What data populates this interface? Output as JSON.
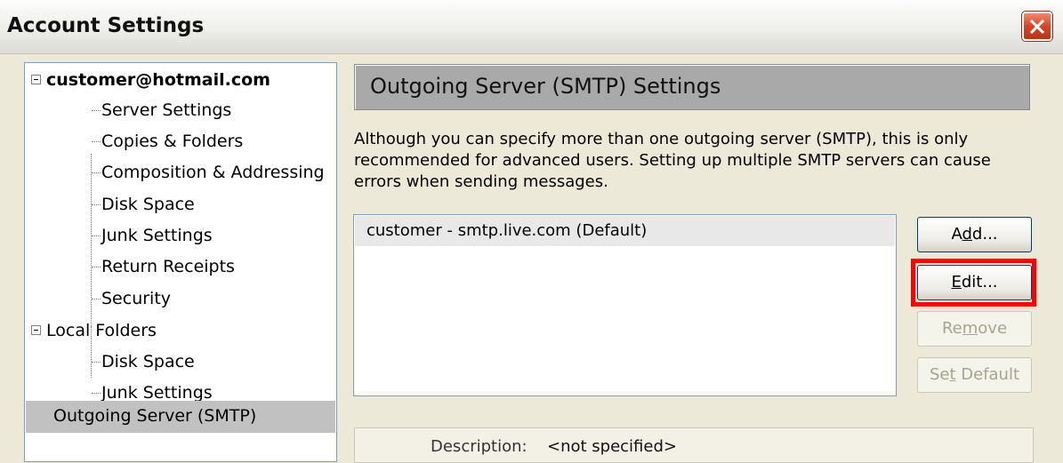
{
  "window": {
    "title": "Account Settings"
  },
  "tree": {
    "account": {
      "label": "customer@hotmail.com",
      "children": [
        "Server Settings",
        "Copies & Folders",
        "Composition & Addressing",
        "Disk Space",
        "Junk Settings",
        "Return Receipts",
        "Security"
      ]
    },
    "local_folders": {
      "label": "Local Folders",
      "children": [
        "Disk Space",
        "Junk Settings"
      ]
    },
    "outgoing": {
      "label": "Outgoing Server (SMTP)"
    }
  },
  "panel": {
    "title": "Outgoing Server (SMTP) Settings",
    "description": "Although you can specify more than one outgoing server (SMTP), this is only recommended for advanced users. Setting up multiple SMTP servers can cause errors when sending messages.",
    "servers": [
      "customer - smtp.live.com (Default)"
    ],
    "buttons": {
      "add_pre": "A",
      "add_key": "d",
      "add_post": "d...",
      "edit_pre": "",
      "edit_key": "E",
      "edit_post": "dit...",
      "remove_pre": "Re",
      "remove_key": "m",
      "remove_post": "ove",
      "setdefault_pre": "Se",
      "setdefault_key": "t",
      "setdefault_post": " Default"
    },
    "details": {
      "description_label": "Description:",
      "description_value": "<not specified>"
    }
  },
  "colors": {
    "highlight": "#ff0000",
    "selection": "#c1c1c1"
  }
}
